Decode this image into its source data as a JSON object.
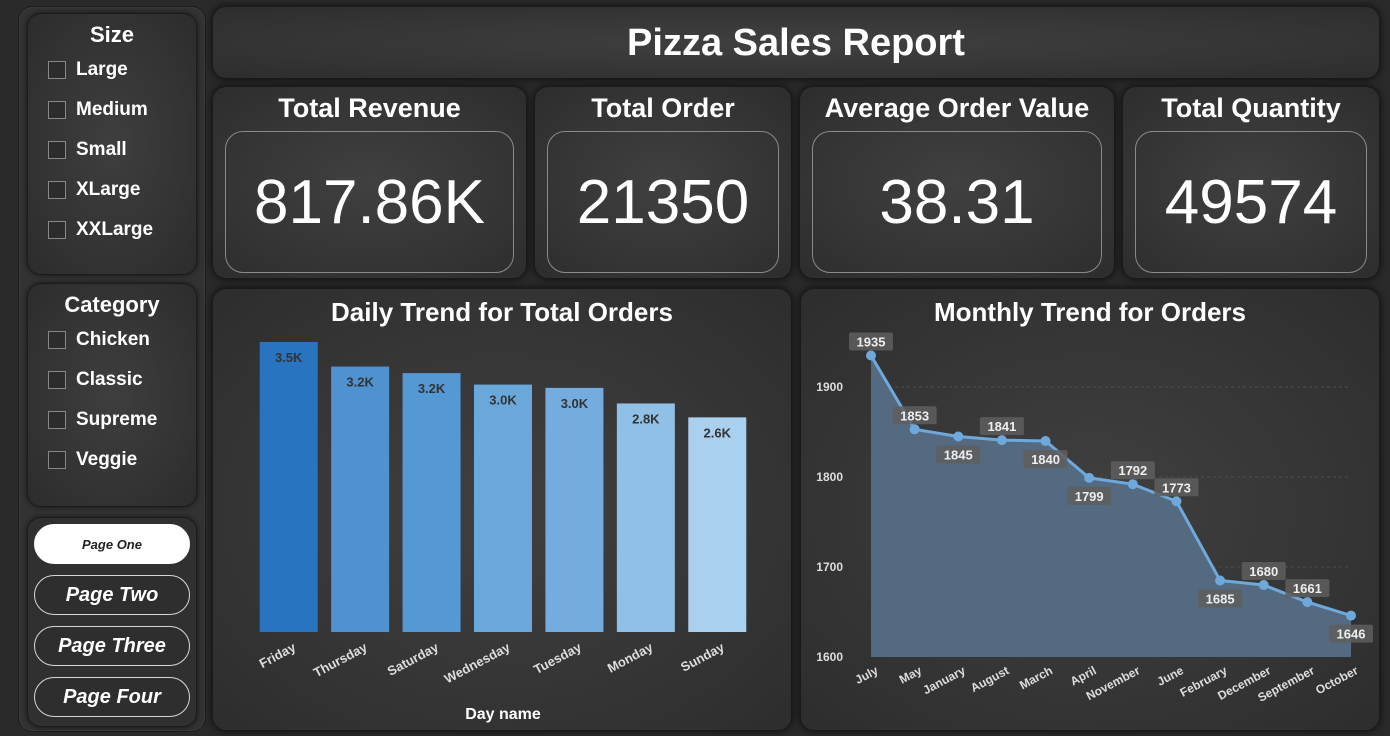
{
  "header": {
    "title": "Pizza Sales Report"
  },
  "size_slicer": {
    "title": "Size",
    "items": [
      "Large",
      "Medium",
      "Small",
      "XLarge",
      "XXLarge"
    ]
  },
  "category_slicer": {
    "title": "Category",
    "items": [
      "Chicken",
      "Classic",
      "Supreme",
      "Veggie"
    ]
  },
  "navigation": {
    "buttons": [
      "Page One",
      "Page Two",
      "Page Three",
      "Page Four"
    ],
    "active": "Page One"
  },
  "kpis": [
    {
      "title": "Total Revenue",
      "value": "817.86K"
    },
    {
      "title": "Total Order",
      "value": "21350"
    },
    {
      "title": "Average Order Value",
      "value": "38.31"
    },
    {
      "title": "Total Quantity",
      "value": "49574"
    }
  ],
  "chart_data": [
    {
      "type": "bar",
      "title": "Daily Trend for Total Orders",
      "xlabel": "Day name",
      "ylabel": "",
      "categories": [
        "Friday",
        "Thursday",
        "Saturday",
        "Wednesday",
        "Tuesday",
        "Monday",
        "Sunday"
      ],
      "values": [
        3540,
        3240,
        3160,
        3020,
        2980,
        2790,
        2620
      ],
      "data_labels": [
        "3.5K",
        "3.2K",
        "3.2K",
        "3.0K",
        "3.0K",
        "2.8K",
        "2.6K"
      ],
      "ylim": [
        0,
        3540
      ],
      "colors": [
        "#2874c1",
        "#4f92cf",
        "#5499d4",
        "#6aa8db",
        "#74addd",
        "#90c0e5",
        "#a9d0ef"
      ]
    },
    {
      "type": "area",
      "title": "Monthly Trend for Orders",
      "xlabel": "",
      "ylabel": "",
      "categories": [
        "July",
        "May",
        "January",
        "August",
        "March",
        "April",
        "November",
        "June",
        "February",
        "December",
        "September",
        "October"
      ],
      "values": [
        1935,
        1853,
        1845,
        1841,
        1840,
        1799,
        1792,
        1773,
        1685,
        1680,
        1661,
        1646
      ],
      "y_ticks": [
        1600,
        1700,
        1800,
        1900
      ],
      "ylim": [
        1600,
        1950
      ],
      "grid": true,
      "line_color": "#6fa9dc",
      "fill_color": "#536a80"
    }
  ]
}
